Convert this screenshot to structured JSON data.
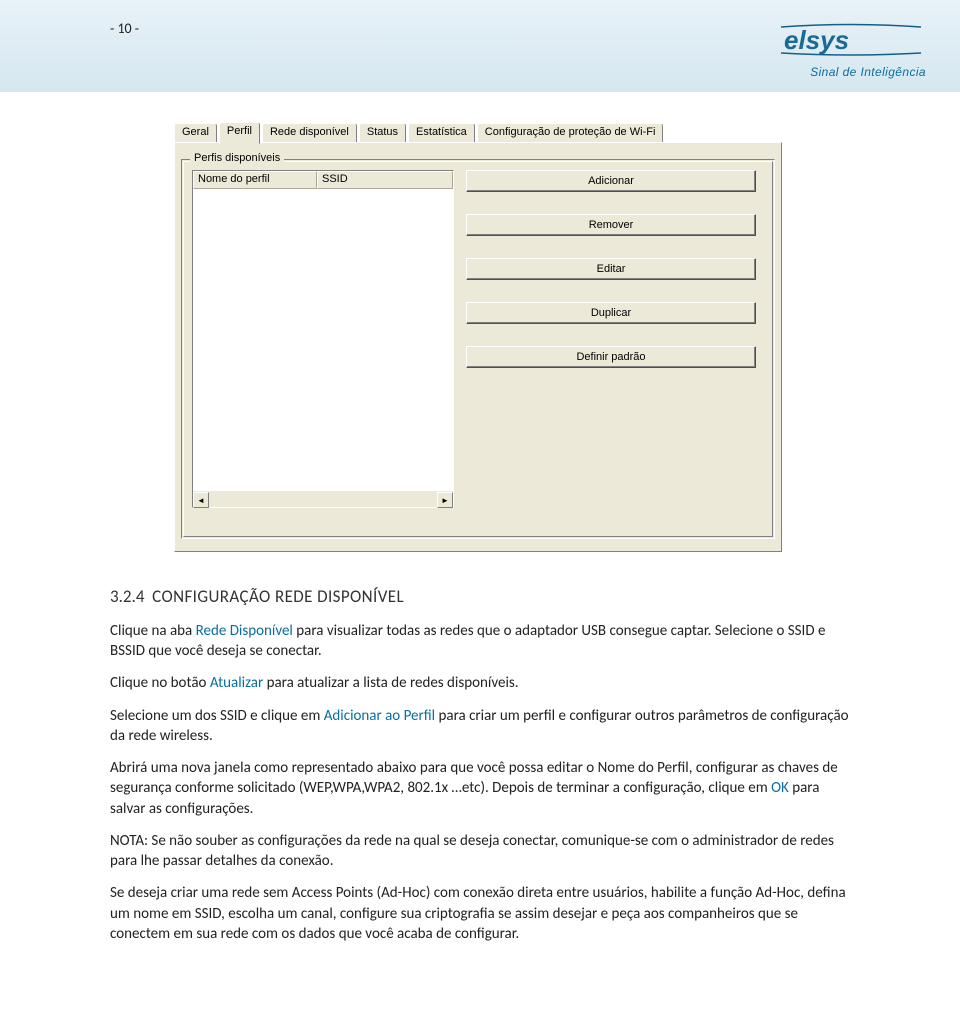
{
  "header": {
    "page_number": "- 10 -",
    "logo_text": "elsys",
    "tagline": "Sinal de Inteligência"
  },
  "dialog": {
    "tabs": [
      "Geral",
      "Perfil",
      "Rede disponível",
      "Status",
      "Estatística",
      "Configuração de proteção de Wi-Fi"
    ],
    "active_tab_index": 1,
    "group_label": "Perfis disponíveis",
    "columns": [
      "Nome do perfil",
      "SSID"
    ],
    "buttons": [
      "Adicionar",
      "Remover",
      "Editar",
      "Duplicar",
      "Definir padrão"
    ]
  },
  "section": {
    "number": "3.2.4",
    "title": "CONFIGURAÇÃO REDE DISPONÍVEL",
    "p1_a": "Clique na aba ",
    "p1_link1": "Rede Disponível",
    "p1_b": " para visualizar todas as redes que o adaptador USB consegue captar. Selecione o SSID e BSSID que você deseja se conectar.",
    "p2_a": "Clique no botão ",
    "p2_link1": "Atualizar",
    "p2_b": " para atualizar a lista de redes disponíveis.",
    "p3_a": "Selecione um dos SSID e clique em ",
    "p3_link1": "Adicionar ao Perfil",
    "p3_b": " para criar um perfil e configurar outros parâmetros de configuração da rede wireless.",
    "p4_a": "Abrirá uma nova janela como representado abaixo para que você possa editar o Nome do Perfil, configurar as chaves de segurança conforme solicitado (WEP,WPA,WPA2, 802.1x …etc). Depois de terminar a configuração, clique em ",
    "p4_link1": "OK",
    "p4_b": " para salvar as configurações.",
    "p5": "NOTA: Se não souber as configurações da rede na qual se deseja conectar, comunique-se com o administrador de redes para lhe passar detalhes da conexão.",
    "p6": "Se deseja criar uma rede sem Access Points (Ad-Hoc) com conexão direta entre usuários, habilite a função Ad-Hoc, defina um nome em SSID, escolha um canal, configure sua criptografia se assim desejar e peça aos companheiros que se conectem em sua rede com os dados que você acaba de configurar."
  }
}
